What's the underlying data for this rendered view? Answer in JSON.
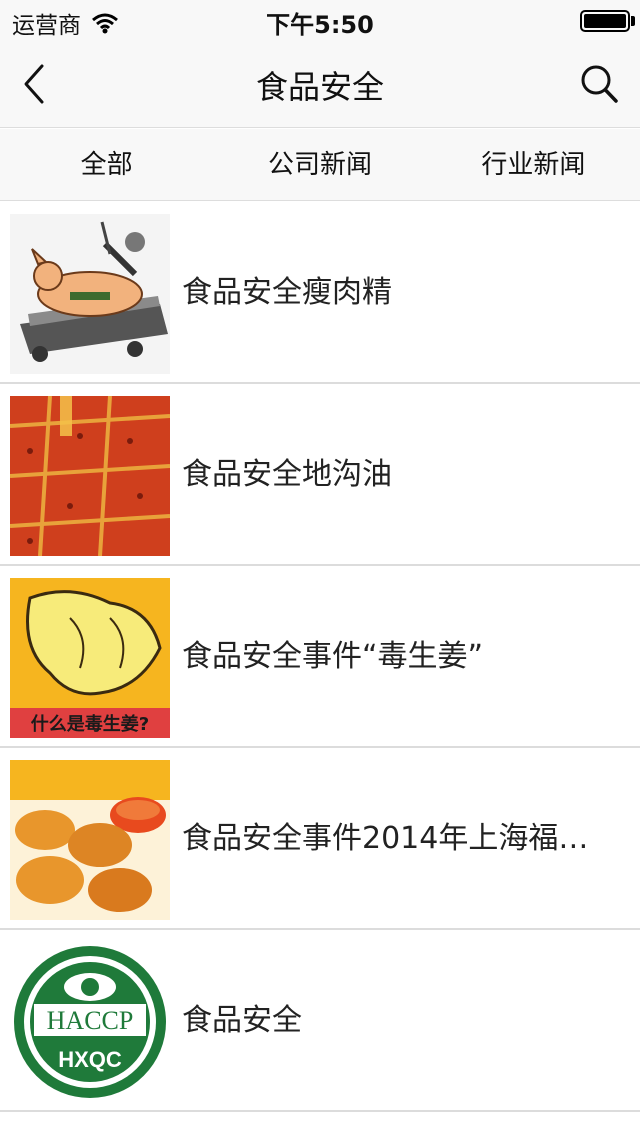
{
  "status_bar": {
    "carrier": "运营商",
    "time": "下午5:50",
    "wifi_icon": "wifi-icon",
    "battery_level": 1.0
  },
  "nav": {
    "title": "食品安全",
    "back_icon": "chevron-left-icon",
    "search_icon": "search-icon"
  },
  "tabs": [
    {
      "label": "全部"
    },
    {
      "label": "公司新闻"
    },
    {
      "label": "行业新闻"
    }
  ],
  "articles": [
    {
      "title": "食品安全瘦肉精",
      "thumb": "pig-injection-cartoon"
    },
    {
      "title": "食品安全地沟油",
      "thumb": "red-oil-hotpot"
    },
    {
      "title": "食品安全事件“毒生姜”",
      "thumb": "ginger-cartoon",
      "thumb_caption": "什么是毒生姜?"
    },
    {
      "title": "食品安全事件2014年上海福…",
      "thumb": "chicken-nuggets"
    },
    {
      "title": "食品安全",
      "thumb": "haccp-logo",
      "logo_text_top": "HACCP",
      "logo_text_bottom": "HXQC"
    }
  ]
}
